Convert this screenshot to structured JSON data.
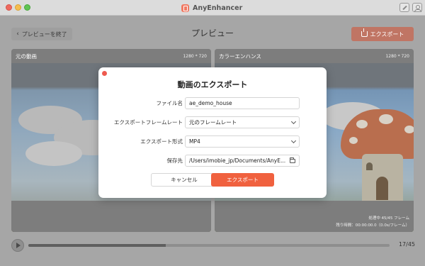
{
  "window": {
    "app_name": "AnyEnhancer"
  },
  "toolbar": {
    "back_label": "プレビューを終了",
    "page_title": "プレビュー",
    "export_label": "エクスポート"
  },
  "panels": {
    "left": {
      "title": "元の動画",
      "resolution": "1280 * 720"
    },
    "right": {
      "title": "カラーエンハンス",
      "resolution": "1280 * 720",
      "processing": "処理中 45/45 フレーム",
      "remaining": "残り時間：00:00:00.0（0.0s/フレーム）"
    }
  },
  "playback": {
    "frame_counter": "17/45",
    "progress_fraction": 0.38
  },
  "export_dialog": {
    "title": "動画のエクスポート",
    "filename_label": "ファイル名",
    "filename_value": "ae_demo_house",
    "framerate_label": "エクスポートフレームレート",
    "framerate_value": "元のフレームレート",
    "format_label": "エクスポート形式",
    "format_value": "MP4",
    "destination_label": "保存先",
    "destination_value": "/Users/imobie_jp/Documents/AnyE...",
    "cancel_label": "キャンセル",
    "export_label": "エクスポート"
  },
  "colors": {
    "accent": "#f0613f",
    "accent_dimmed": "#c07564",
    "close_dot": "#ee5a4f"
  },
  "icons": {
    "back": "chevron-left-icon",
    "export": "export-icon",
    "edit": "edit-icon",
    "user": "user-icon",
    "play": "play-icon",
    "dropdown": "chevron-down-icon",
    "folder": "folder-icon"
  }
}
